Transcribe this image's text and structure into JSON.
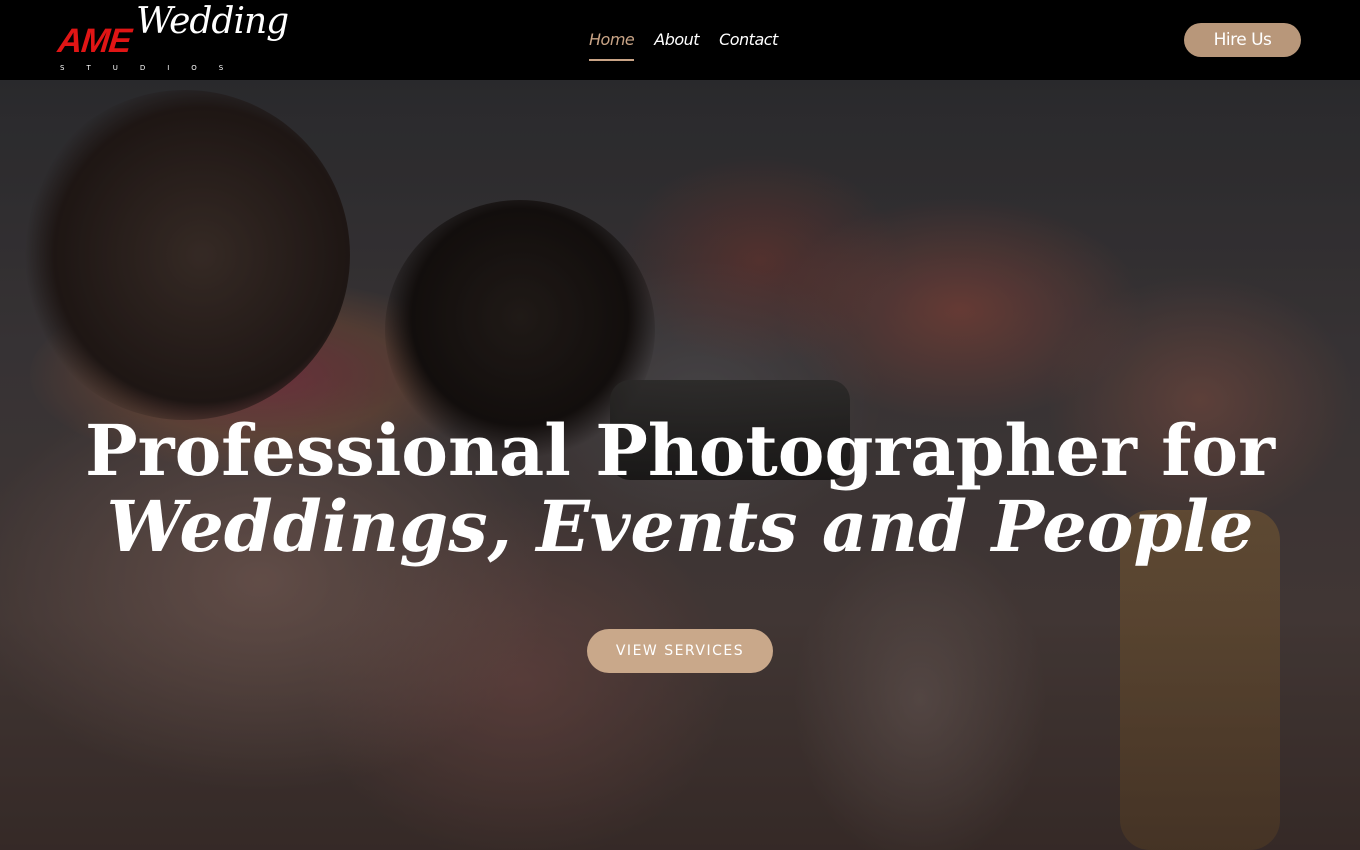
{
  "brand": {
    "logo_ame": "AME",
    "logo_wedding": "Wedding",
    "logo_studios": "STUDIOS",
    "accent_color": "#c9a486",
    "logo_red": "#e01515"
  },
  "nav": {
    "items": [
      {
        "label": "Home",
        "active": true
      },
      {
        "label": "About",
        "active": false
      },
      {
        "label": "Contact",
        "active": false
      }
    ],
    "cta_label": "Hire Us"
  },
  "hero": {
    "title": "Professional Photographer for",
    "subtitle": "Weddings, Events and People",
    "button_label": "VIEW SERVICES",
    "background": "wedding photographer with camera and flower garland"
  }
}
